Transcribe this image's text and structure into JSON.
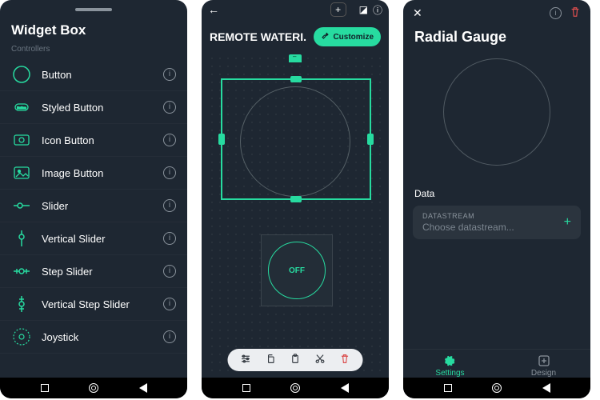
{
  "screen1": {
    "title": "Widget Box",
    "section": "Controllers",
    "items": [
      {
        "label": "Button",
        "icon": "circle-icon"
      },
      {
        "label": "Styled Button",
        "icon": "pill-icon"
      },
      {
        "label": "Icon Button",
        "icon": "camera-square-icon"
      },
      {
        "label": "Image Button",
        "icon": "picture-square-icon"
      },
      {
        "label": "Slider",
        "icon": "hslider-icon"
      },
      {
        "label": "Vertical Slider",
        "icon": "vslider-icon"
      },
      {
        "label": "Step Slider",
        "icon": "hstep-icon"
      },
      {
        "label": "Vertical Step Slider",
        "icon": "vstep-icon"
      },
      {
        "label": "Joystick",
        "icon": "joystick-icon"
      }
    ]
  },
  "screen2": {
    "device_name": "REMOTE WATERI...",
    "customize_label": "Customize",
    "button_state": "OFF"
  },
  "screen3": {
    "title": "Radial Gauge",
    "section": "Data",
    "field_label": "DATASTREAM",
    "field_placeholder": "Choose datastream...",
    "tab_settings": "Settings",
    "tab_design": "Design"
  },
  "colors": {
    "accent": "#27dba0",
    "bg": "#1e2732",
    "danger": "#d94d4d"
  }
}
